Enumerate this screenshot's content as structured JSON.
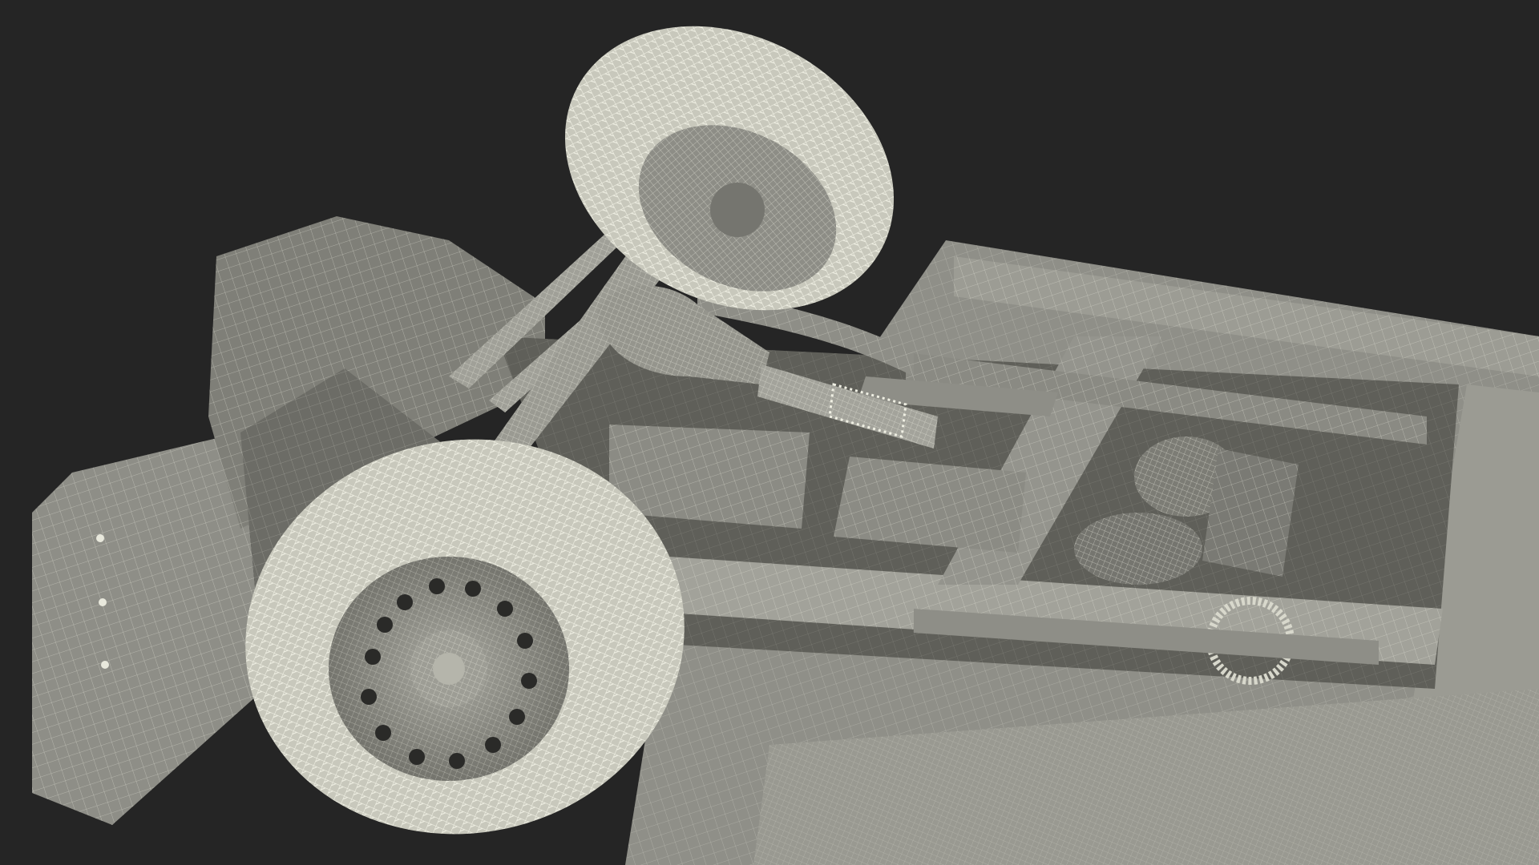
{
  "scene": {
    "background": "#252525",
    "model_fill": "#8b8b84",
    "model_fill_light": "#a3a39b",
    "model_fill_dark": "#5f5f59",
    "wire_color": "#e8e8dc",
    "tire_fill": "#b9b9ad",
    "objects": [
      "vehicle-chassis-underside",
      "front-tire",
      "rear-tire",
      "wheel-rim",
      "drive-shaft",
      "differential",
      "frame-rails",
      "leaf-springs",
      "fuel-tanks",
      "transfer-case",
      "exhaust-pipe",
      "body-panels"
    ]
  }
}
